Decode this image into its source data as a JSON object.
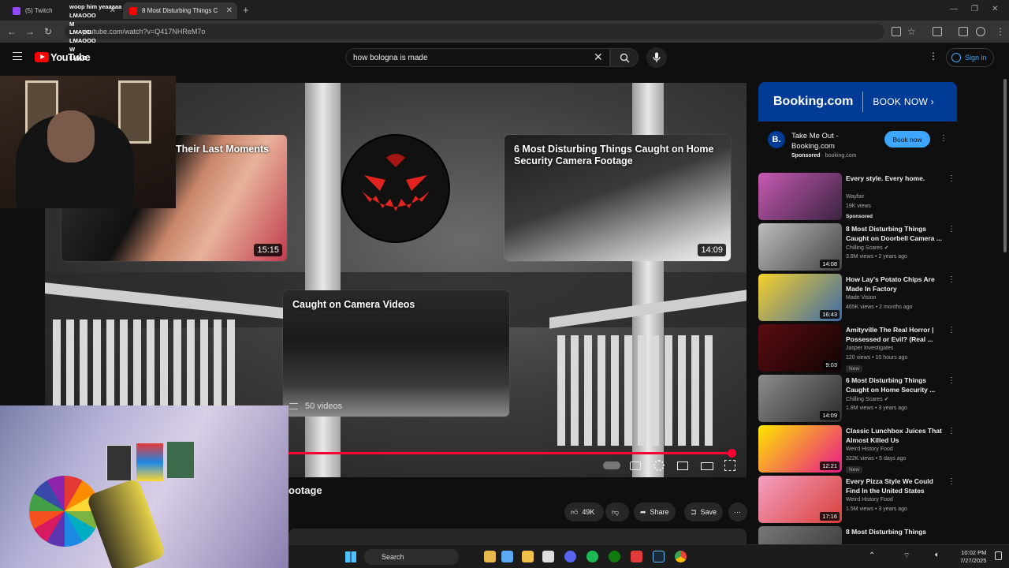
{
  "browser": {
    "tabs": [
      {
        "label": "(5) Twitch",
        "color": "#9146ff"
      },
      {
        "label": "8 Most Disturbing Things C",
        "color": "#ff0000"
      }
    ],
    "url": "youtube.com/watch?v=Q417NHReM7o"
  },
  "youtube": {
    "logo_text": "YouTube",
    "search_value": "how bologna is made",
    "sign_in_label": "Sign in"
  },
  "player": {
    "progress_fraction": 0.995,
    "end_cards": [
      {
        "title": "Their Last Moments",
        "duration": "15:15"
      },
      {
        "title": "6 Most Disturbing Things Caught on Home Security Camera Footage",
        "duration": "14:09"
      },
      {
        "title": "Caught on Camera Videos",
        "playlist_count": "50 videos"
      }
    ]
  },
  "video": {
    "title_fragment": "ootage",
    "likes": "49K",
    "share_label": "Share",
    "save_label": "Save"
  },
  "ad": {
    "banner_brand": "Booking.com",
    "banner_cta": "BOOK NOW ›",
    "logo_letter": "B.",
    "title": "Take Me Out - Booking.com",
    "sponsored": "Sponsored",
    "domain": "booking.com",
    "button": "Book now"
  },
  "recommendations": [
    {
      "title": "Every style. Every home.",
      "channel": "Wayfair",
      "meta": "19K views",
      "badge": "Sponsored",
      "duration": "",
      "colors": [
        "#c65ab2",
        "#3a2340"
      ]
    },
    {
      "title": "8 Most Disturbing Things Caught on Doorbell Camera ...",
      "channel": "Chilling Scares ✔",
      "meta": "3.8M views • 2 years ago",
      "duration": "14:08",
      "colors": [
        "#bdbdbd",
        "#444"
      ]
    },
    {
      "title": "How Lay's Potato Chips Are Made In Factory",
      "channel": "Made Vision",
      "meta": "465K views • 2 months ago",
      "duration": "16:43",
      "colors": [
        "#f6d12a",
        "#3c6aa8"
      ]
    },
    {
      "title": "Amityville The Real Horror | Possessed or Evil? (Real ...",
      "channel": "Jasper Investigates",
      "meta": "120 views • 10 hours ago",
      "new": "New",
      "duration": "9:03",
      "colors": [
        "#5a0c10",
        "#120404"
      ]
    },
    {
      "title": "6 Most Disturbing Things Caught on Home Security ...",
      "channel": "Chilling Scares ✔",
      "meta": "1.8M views • 3 years ago",
      "duration": "14:09",
      "colors": [
        "#8d8d8d",
        "#2b2b2b"
      ]
    },
    {
      "title": "Classic Lunchbox Juices That Almost Killed Us",
      "channel": "Weird History Food",
      "meta": "322K views • 5 days ago",
      "new": "New",
      "duration": "12:21",
      "colors": [
        "#ffe600",
        "#e9198a"
      ]
    },
    {
      "title": "Every Pizza Style We Could Find In the United States",
      "channel": "Weird History Food",
      "meta": "1.5M views • 3 years ago",
      "duration": "17:16",
      "colors": [
        "#f4a0c2",
        "#d8403a"
      ]
    },
    {
      "title": "8 Most Disturbing Things",
      "channel": "",
      "meta": "",
      "duration": "",
      "colors": [
        "#777",
        "#333"
      ]
    }
  ],
  "chat": [
    {
      "user": "",
      "msg": "woop him yeaaaaa",
      "color": "#b05cff"
    },
    {
      "user": "",
      "msg": "LMAOOO",
      "color": "#ff6a6a"
    },
    {
      "user": "",
      "msg": "M",
      "color": "#ff6a6a"
    },
    {
      "user": "",
      "msg": "LMAOO",
      "color": "#ff6a6a"
    },
    {
      "user": "",
      "msg": "LMAOOO",
      "color": "#ff6a6a"
    },
    {
      "user": "",
      "msg": "W",
      "color": "#3ddc84"
    },
    {
      "user": "",
      "msg": "LMAO",
      "color": "#8a5cff"
    }
  ],
  "taskbar": {
    "search_label": "Search",
    "time": "10:02 PM",
    "date": "7/27/2025"
  }
}
